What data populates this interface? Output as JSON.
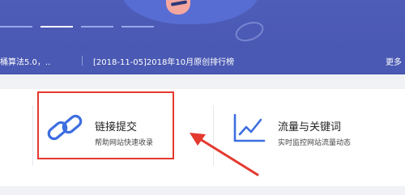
{
  "banner": {
    "news": [
      {
        "text": "桶算法5.0，.."
      },
      {
        "text": "[2018-11-05]2018年10月原创排行榜"
      },
      {
        "text": "更多"
      }
    ]
  },
  "tools": [
    {
      "title": "链接提交",
      "subtitle": "帮助网站快速收录",
      "icon": "link-icon"
    },
    {
      "title": "流量与关键词",
      "subtitle": "实时监控网站流量动态",
      "icon": "trend-chart-icon"
    }
  ],
  "colors": {
    "banner": "#4e5db8",
    "accent_blue": "#3d6ee0",
    "highlight_red": "#e4392f"
  }
}
